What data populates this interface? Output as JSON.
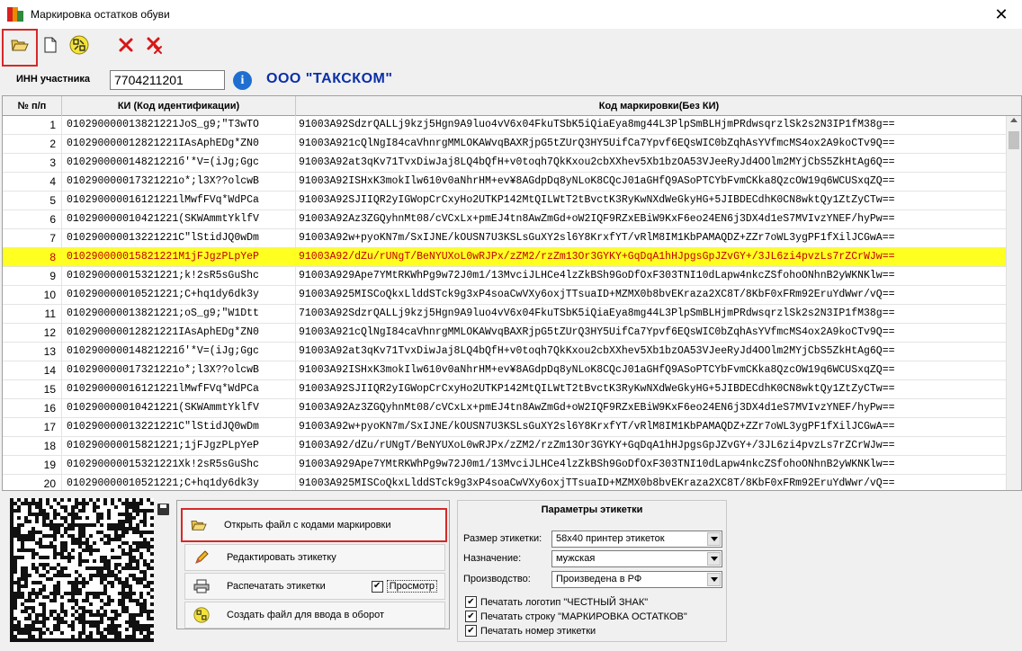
{
  "window": {
    "title": "Маркировка остатков обуви",
    "close_glyph": "✕"
  },
  "toolbar": {
    "buttons": [
      {
        "name": "open-folder-icon"
      },
      {
        "name": "new-document-icon"
      },
      {
        "name": "qr-code-icon"
      },
      {
        "name": "delete-red-x-icon"
      },
      {
        "name": "delete-all-red-x-icon"
      }
    ]
  },
  "inn": {
    "label": "ИНН участника",
    "value": "7704211201",
    "org_name": "ООО \"ТАКСКОМ\""
  },
  "table": {
    "columns": [
      "№ п/п",
      "КИ (Код идентификации)",
      "Код маркировки(Без КИ)"
    ],
    "selected_row": 8,
    "rows": [
      {
        "n": "1",
        "ki": "010290000013821221JoS_g9;\"T3wTO",
        "code": "91003A92SdzrQALLj9kzj5Hgn9A9luo4vV6x04FkuTSbK5iQiaEya8mg44L3PlpSmBLHjmPRdwsqrzlSk2s2N3IP1fM38g=="
      },
      {
        "n": "2",
        "ki": "010290000012821221IAsAphEDg*ZN0",
        "code": "91003A921cQlNgI84caVhnrgMMLOKAWvqBAXRjpG5tZUrQ3HY5UifCa7Ypvf6EQsWIC0bZqhAsYVfmcMS4ox2A9koCTv9Q=="
      },
      {
        "n": "3",
        "ki": "010290000014821221б'*V=(iJg;Ggc",
        "code": "91003A92at3qKv71TvxDiwJaj8LQ4bQfH+v0toqh7QkKxou2cbXXhev5Xb1bzOA53VJeeRyJd4OOlm2MYjCbS5ZkHtAg6Q=="
      },
      {
        "n": "4",
        "ki": "010290000017321221o*;l3X??olcwB",
        "code": "91003A92ISHxK3mokIlw610v0aNhrHM+ev¥8AGdpDq8yNLoK8CQcJ01aGHfQ9ASoPTCYbFvmCKka8QzcOW19q6WCUSxqZQ=="
      },
      {
        "n": "5",
        "ki": "010290000016121221lMwfFVq*WdPCa",
        "code": "91003A92SJIIQR2yIGWopCrCxyHo2UTKP142MtQILWtT2tBvctK3RyKwNXdWeGkyHG+5JIBDECdhK0CN8wktQy1ZtZyCTw=="
      },
      {
        "n": "6",
        "ki": "010290000010421221(SKWAmmtYklfV",
        "code": "91003A92Az3ZGQyhnMt08/cVCxLx+pmEJ4tn8AwZmGd+oW2IQF9RZxEBiW9KxF6eo24EN6j3DX4d1eS7MVIvzYNEF/hyPw=="
      },
      {
        "n": "7",
        "ki": "010290000013221221C\"lStidJQ0wDm",
        "code": "91003A92w+pyoKN7m/SxIJNE/kOUSN7U3KSLsGuXY2sl6Y8KrxfYT/vRlM8IM1KbPAMAQDZ+ZZr7oWL3ygPF1fXilJCGwA=="
      },
      {
        "n": "8",
        "ki": "010290000015821221M1jFJgzPLpYeP",
        "code": "91003A92/dZu/rUNgT/BeNYUXoL0wRJPx/zZM2/rzZm13Or3GYKY+GqDqA1hHJpgsGpJZvGY+/3JL6zi4pvzLs7rZCrWJw=="
      },
      {
        "n": "9",
        "ki": "010290000015321221;k!2sR5sGuShc",
        "code": "91003A929Ape7YMtRKWhPg9w72J0m1/13MvciJLHCe4lzZkBSh9GoDfOxF303TNI10dLapw4nkcZSfohoONhnB2yWKNKlw=="
      },
      {
        "n": "10",
        "ki": "010290000010521221;C+hq1dy6dk3y",
        "code": "91003A925MISCoQkxLlddSTck9g3xP4soaCwVXy6oxjTTsuaID+MZMX0b8bvEKraza2XC8T/8KbF0xFRm92EruYdWwr/vQ=="
      },
      {
        "n": "11",
        "ki": "010290000013821221;oS_g9;\"W1Dtt",
        "code": " 71003A92SdzrQALLj9kzj5Hgn9A9luo4vV6x04FkuTSbK5iQiaEya8mg44L3PlpSmBLHjmPRdwsqrzlSk2s2N3IP1fM38g=="
      },
      {
        "n": "12",
        "ki": "010290000012821221IAsAphEDg*ZN0",
        "code": "91003A921cQlNgI84caVhnrgMMLOKAWvqBAXRjpG5tZUrQ3HY5UifCa7Ypvf6EQsWIC0bZqhAsYVfmcMS4ox2A9koCTv9Q=="
      },
      {
        "n": "13",
        "ki": "010290000014821221б'*V=(iJg;Ggc",
        "code": "91003A92at3qKv71TvxDiwJaj8LQ4bQfH+v0toqh7QkKxou2cbXXhev5Xb1bzOA53VJeeRyJd4OOlm2MYjCbS5ZkHtAg6Q=="
      },
      {
        "n": "14",
        "ki": "010290000017321221o*;l3X??olcwB",
        "code": "91003A92ISHxK3mokIlw610v0aNhrHM+ev¥8AGdpDq8yNLoK8CQcJ01aGHfQ9ASoPTCYbFvmCKka8QzcOW19q6WCUSxqZQ=="
      },
      {
        "n": "15",
        "ki": "010290000016121221lMwfFVq*WdPCa",
        "code": "91003A92SJIIQR2yIGWopCrCxyHo2UTKP142MtQILWtT2tBvctK3RyKwNXdWeGkyHG+5JIBDECdhK0CN8wktQy1ZtZyCTw=="
      },
      {
        "n": "16",
        "ki": "010290000010421221(SKWAmmtYklfV",
        "code": "91003A92Az3ZGQyhnMt08/cVCxLx+pmEJ4tn8AwZmGd+oW2IQF9RZxEBiW9KxF6eo24EN6j3DX4d1eS7MVIvzYNEF/hyPw=="
      },
      {
        "n": "17",
        "ki": "010290000013221221C\"lStidJQ0wDm",
        "code": "91003A92w+pyoKN7m/SxIJNE/kOUSN7U3KSLsGuXY2sl6Y8KrxfYT/vRlM8IM1KbPAMAQDZ+ZZr7oWL3ygPF1fXilJCGwA=="
      },
      {
        "n": "18",
        "ki": "010290000015821221;1jFJgzPLpYeP",
        "code": "91003A92/dZu/rUNgT/BeNYUXoL0wRJPx/zZM2/rzZm13Or3GYKY+GqDqA1hHJpgsGpJZvGY+/3JL6zi4pvzLs7rZCrWJw=="
      },
      {
        "n": "19",
        "ki": "010290000015321221Xk!2sR5sGuShc",
        "code": "91003A929Ape7YMtRKWhPg9w72J0m1/13MvciJLHCe4lzZkBSh9GoDfOxF303TNI10dLapw4nkcZSfohoONhnB2yWKNKlw=="
      },
      {
        "n": "20",
        "ki": "010290000010521221;C+hq1dy6dk3y",
        "code": "91003A925MISCoQkxLlddSTck9g3xP4soaCwVXy6oxjTTsuaID+MZMX0b8bvEKraza2XC8T/8KbF0xFRm92EruYdWwr/vQ=="
      }
    ]
  },
  "actions": {
    "open_file": "Открыть файл с кодами маркировки",
    "edit_label": "Редактировать этикетку",
    "print_labels": "Распечатать этикетки",
    "preview": "Просмотр",
    "create_file": "Создать файл для ввода в оборот"
  },
  "params": {
    "title": "Параметры этикетки",
    "size_label": "Размер этикетки:",
    "size_value": "58x40 принтер этикеток",
    "purpose_label": "Назначение:",
    "purpose_value": "мужская",
    "production_label": "Производство:",
    "production_value": "Произведена в РФ",
    "check_logo": "Печатать логотип \"ЧЕСТНЫЙ ЗНАК\"",
    "check_line": "Печатать строку \"МАРКИРОВКА ОСТАТКОВ\"",
    "check_number": "Печатать номер этикетки"
  },
  "colors": {
    "highlight_border": "#d62828",
    "selected_row_bg": "#ffff20",
    "selected_row_text": "#c00000",
    "org_name": "#0a2fa8"
  }
}
